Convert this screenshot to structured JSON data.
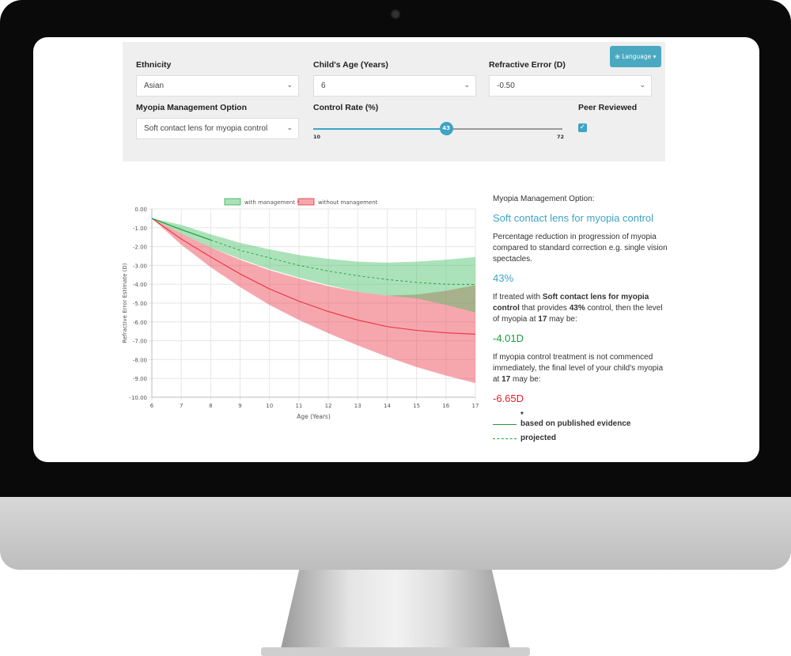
{
  "form": {
    "language_label": "Language",
    "ethnicity": {
      "label": "Ethnicity",
      "value": "Asian"
    },
    "age": {
      "label": "Child's Age (Years)",
      "value": "6"
    },
    "refractive": {
      "label": "Refractive Error (D)",
      "value": "-0.50"
    },
    "option": {
      "label": "Myopia Management Option",
      "value": "Soft contact lens for myopia control"
    },
    "control_rate": {
      "label": "Control Rate (%)",
      "value": "43",
      "min": "10",
      "max": "72"
    },
    "peer": {
      "label": "Peer Reviewed",
      "checked": true
    }
  },
  "side": {
    "heading": "Myopia Management Option:",
    "option": "Soft contact lens for myopia control",
    "desc": "Percentage reduction in progression of myopia compared to standard correction e.g. single vision spectacles.",
    "rate": "43%",
    "t1a": "If treated with ",
    "t1b": "Soft contact lens for myopia control",
    "t1c": " that provides ",
    "t1d": "43%",
    "t1e": " control, then the level of myopia at ",
    "t1f": "17",
    "t1g": " may be:",
    "with_result": "-4.01D",
    "t2a": "If myopia control treatment is not commenced immediately, the final level of your child's myopia at ",
    "t2b": "17",
    "t2c": " may be:",
    "without_result": "-6.65D",
    "star": "*",
    "legend_solid": "based on published evidence",
    "legend_dashed": "projected"
  },
  "colors": {
    "accent": "#3ea4c4",
    "with": "#2eb24a",
    "without": "#e8323c"
  },
  "chart_data": {
    "type": "area",
    "xlabel": "Age (Years)",
    "ylabel": "Refractive Error Estimate (D)",
    "xlim": [
      6,
      17
    ],
    "ylim": [
      -10,
      0
    ],
    "x": [
      6,
      7,
      8,
      9,
      10,
      11,
      12,
      13,
      14,
      15,
      16,
      17
    ],
    "yticks": [
      "0.00",
      "-1.00",
      "-2.00",
      "-3.00",
      "-4.00",
      "-5.00",
      "-6.00",
      "-7.00",
      "-8.00",
      "-9.00",
      "-10.00"
    ],
    "grid": true,
    "legend": "top",
    "series": [
      {
        "name": "with management *",
        "mean": [
          -0.5,
          -1.1,
          -1.65,
          -2.2,
          -2.6,
          -3.0,
          -3.3,
          -3.55,
          -3.75,
          -3.9,
          -4.0,
          -4.01
        ],
        "upper": [
          -0.5,
          -0.85,
          -1.35,
          -1.8,
          -2.15,
          -2.45,
          -2.65,
          -2.8,
          -2.85,
          -2.8,
          -2.7,
          -2.55
        ],
        "lower": [
          -0.5,
          -1.3,
          -2.05,
          -2.65,
          -3.2,
          -3.65,
          -4.05,
          -4.4,
          -4.6,
          -4.75,
          -5.1,
          -5.5
        ],
        "solid_until": 8
      },
      {
        "name": "without management",
        "mean": [
          -0.5,
          -1.6,
          -2.55,
          -3.45,
          -4.25,
          -4.9,
          -5.45,
          -5.9,
          -6.25,
          -6.45,
          -6.58,
          -6.65
        ],
        "upper": [
          -0.5,
          -1.3,
          -2.05,
          -2.7,
          -3.25,
          -3.7,
          -4.1,
          -4.4,
          -4.6,
          -4.55,
          -4.35,
          -4.05
        ],
        "lower": [
          -0.5,
          -1.9,
          -3.1,
          -4.15,
          -5.1,
          -5.9,
          -6.6,
          -7.25,
          -7.85,
          -8.4,
          -8.85,
          -9.25
        ]
      }
    ]
  }
}
